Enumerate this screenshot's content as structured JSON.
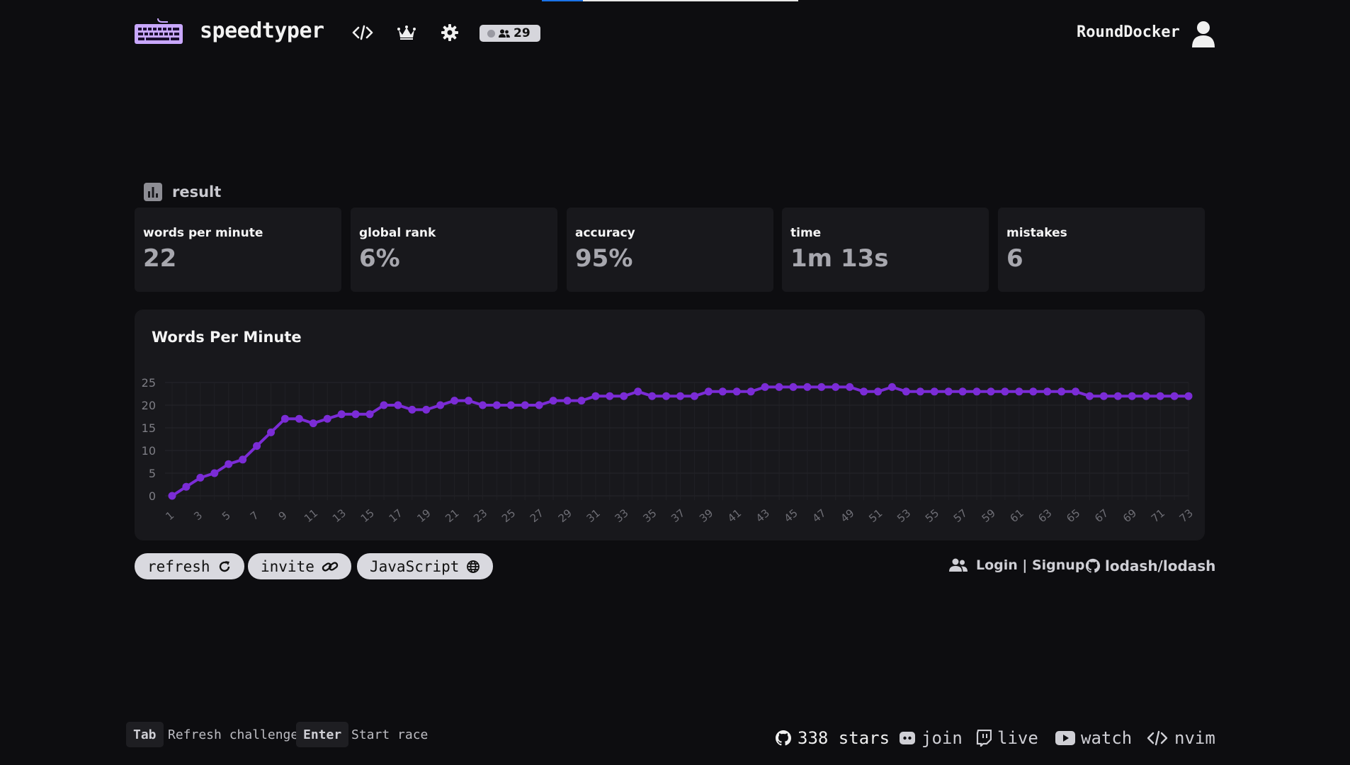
{
  "header": {
    "brand": "speedtyper",
    "username": "RoundDocker",
    "online_count": "29",
    "nav_icons": [
      "code-icon",
      "crown-icon",
      "gear-icon"
    ],
    "progress": 0.16
  },
  "result": {
    "label": "result",
    "stats": [
      {
        "title": "words per minute",
        "value": "22"
      },
      {
        "title": "global rank",
        "value": "6%"
      },
      {
        "title": "accuracy",
        "value": "95%"
      },
      {
        "title": "time",
        "value": "1m 13s"
      },
      {
        "title": "mistakes",
        "value": "6"
      }
    ]
  },
  "chart_data": {
    "type": "line",
    "title": "Words Per Minute",
    "xlabel": "",
    "ylabel": "",
    "ylim": [
      0,
      25
    ],
    "yticks": [
      0,
      5,
      10,
      15,
      20,
      25
    ],
    "x": [
      1,
      2,
      3,
      4,
      5,
      6,
      7,
      8,
      9,
      10,
      11,
      12,
      13,
      14,
      15,
      16,
      17,
      18,
      19,
      20,
      21,
      22,
      23,
      24,
      25,
      26,
      27,
      28,
      29,
      30,
      31,
      32,
      33,
      34,
      35,
      36,
      37,
      38,
      39,
      40,
      41,
      42,
      43,
      44,
      45,
      46,
      47,
      48,
      49,
      50,
      51,
      52,
      53,
      54,
      55,
      56,
      57,
      58,
      59,
      60,
      61,
      62,
      63,
      64,
      65,
      66,
      67,
      68,
      69,
      70,
      71,
      72,
      73
    ],
    "xtick_labels": [
      "1",
      "3",
      "5",
      "7",
      "9",
      "11",
      "13",
      "15",
      "17",
      "19",
      "21",
      "23",
      "25",
      "27",
      "29",
      "31",
      "33",
      "35",
      "37",
      "39",
      "41",
      "43",
      "45",
      "47",
      "49",
      "51",
      "53",
      "55",
      "57",
      "59",
      "61",
      "63",
      "65",
      "67",
      "69",
      "71",
      "73"
    ],
    "series": [
      {
        "color": "#7b2cd6",
        "values": [
          0,
          2,
          4,
          5,
          7,
          8,
          11,
          14,
          17,
          17,
          16,
          17,
          18,
          18,
          18,
          20,
          20,
          19,
          19,
          20,
          21,
          21,
          20,
          20,
          20,
          20,
          20,
          21,
          21,
          21,
          22,
          22,
          22,
          23,
          22,
          22,
          22,
          22,
          23,
          23,
          23,
          23,
          24,
          24,
          24,
          24,
          24,
          24,
          24,
          23,
          23,
          24,
          23,
          23,
          23,
          23,
          23,
          23,
          23,
          23,
          23,
          23,
          23,
          23,
          23,
          22,
          22,
          22,
          22,
          22,
          22,
          22,
          22
        ]
      }
    ],
    "grid": true
  },
  "actions": {
    "refresh": "refresh",
    "invite": "invite",
    "language": "JavaScript",
    "login": "Login | Signup",
    "repo": "lodash/lodash"
  },
  "footer": {
    "tab_key": "Tab",
    "tab_hint": "Refresh challenge",
    "enter_key": "Enter",
    "enter_hint": "Start race",
    "stars": "338 stars",
    "join": "join",
    "live": "live",
    "watch": "watch",
    "nvim": "nvim"
  },
  "colors": {
    "accent": "#7b2cd6",
    "logo": "#c9a8ff",
    "background": "#0d0d10",
    "card": "#18181c"
  }
}
